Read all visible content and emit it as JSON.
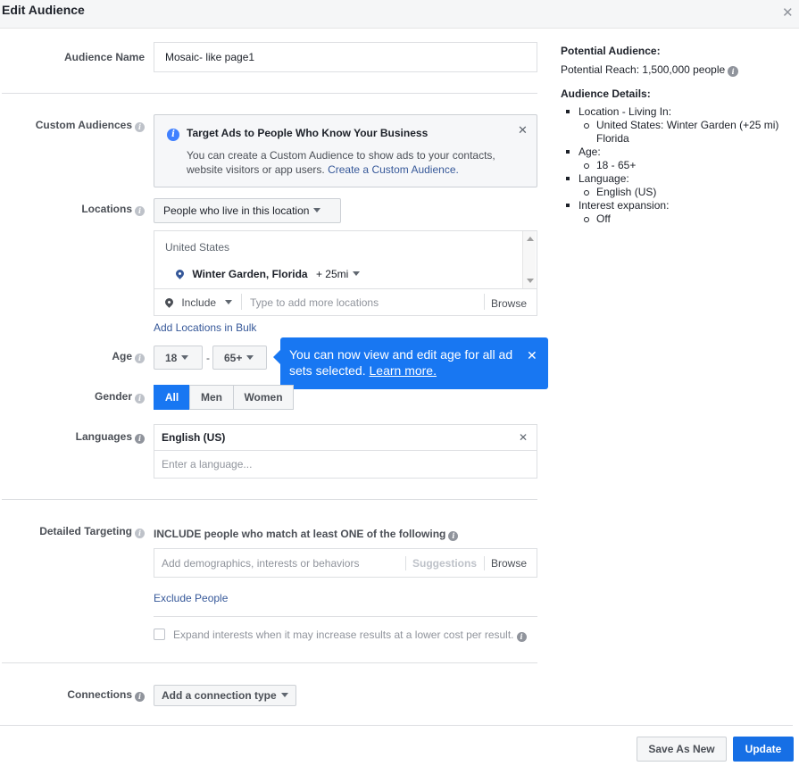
{
  "dialog": {
    "title": "Edit Audience"
  },
  "audience_name": {
    "label": "Audience Name",
    "value": "Mosaic- like page1"
  },
  "custom_audiences": {
    "label": "Custom Audiences",
    "info_title": "Target Ads to People Who Know Your Business",
    "info_text": "You can create a Custom Audience to show ads to your contacts, website visitors or app users.",
    "info_link": "Create a Custom Audience."
  },
  "locations": {
    "label": "Locations",
    "dropdown": "People who live in this location",
    "country": "United States",
    "city": "Winter Garden, Florida",
    "radius": "+ 25mi",
    "include_label": "Include",
    "input_placeholder": "Type to add more locations",
    "browse": "Browse",
    "bulk_link": "Add Locations in Bulk"
  },
  "age": {
    "label": "Age",
    "min": "18",
    "separator": "-",
    "max": "65+",
    "tooltip_text": "You can now view and edit age for all ad sets selected.",
    "tooltip_link": "Learn more."
  },
  "gender": {
    "label": "Gender",
    "options": [
      "All",
      "Men",
      "Women"
    ],
    "selected": "All"
  },
  "languages": {
    "label": "Languages",
    "selected": "English (US)",
    "placeholder": "Enter a language..."
  },
  "detailed_targeting": {
    "label": "Detailed Targeting",
    "description": "INCLUDE people who match at least ONE of the following",
    "placeholder": "Add demographics, interests or behaviors",
    "suggestions": "Suggestions",
    "browse": "Browse",
    "exclude_link": "Exclude People",
    "expand_label": "Expand interests when it may increase results at a lower cost per result."
  },
  "connections": {
    "label": "Connections",
    "dropdown": "Add a connection type"
  },
  "summary": {
    "potential_heading": "Potential Audience:",
    "reach_label": "Potential Reach:",
    "reach_value": "1,500,000 people",
    "details_heading": "Audience Details:",
    "location_heading": "Location - Living In:",
    "location_value_1": "United States: Winter Garden (+25 mi)",
    "location_value_2": "Florida",
    "age_heading": "Age:",
    "age_value": "18 - 65+",
    "language_heading": "Language:",
    "language_value": "English (US)",
    "interest_heading": "Interest expansion:",
    "interest_value": "Off"
  },
  "footer": {
    "save_as_new": "Save As New",
    "update": "Update"
  },
  "colors": {
    "accent": "#1877f2",
    "link": "#365899",
    "update_button": "#166fe5"
  },
  "icons": {
    "close": "close-icon",
    "info": "info-icon",
    "pin": "location-pin-icon",
    "caret": "chevron-down-icon"
  }
}
